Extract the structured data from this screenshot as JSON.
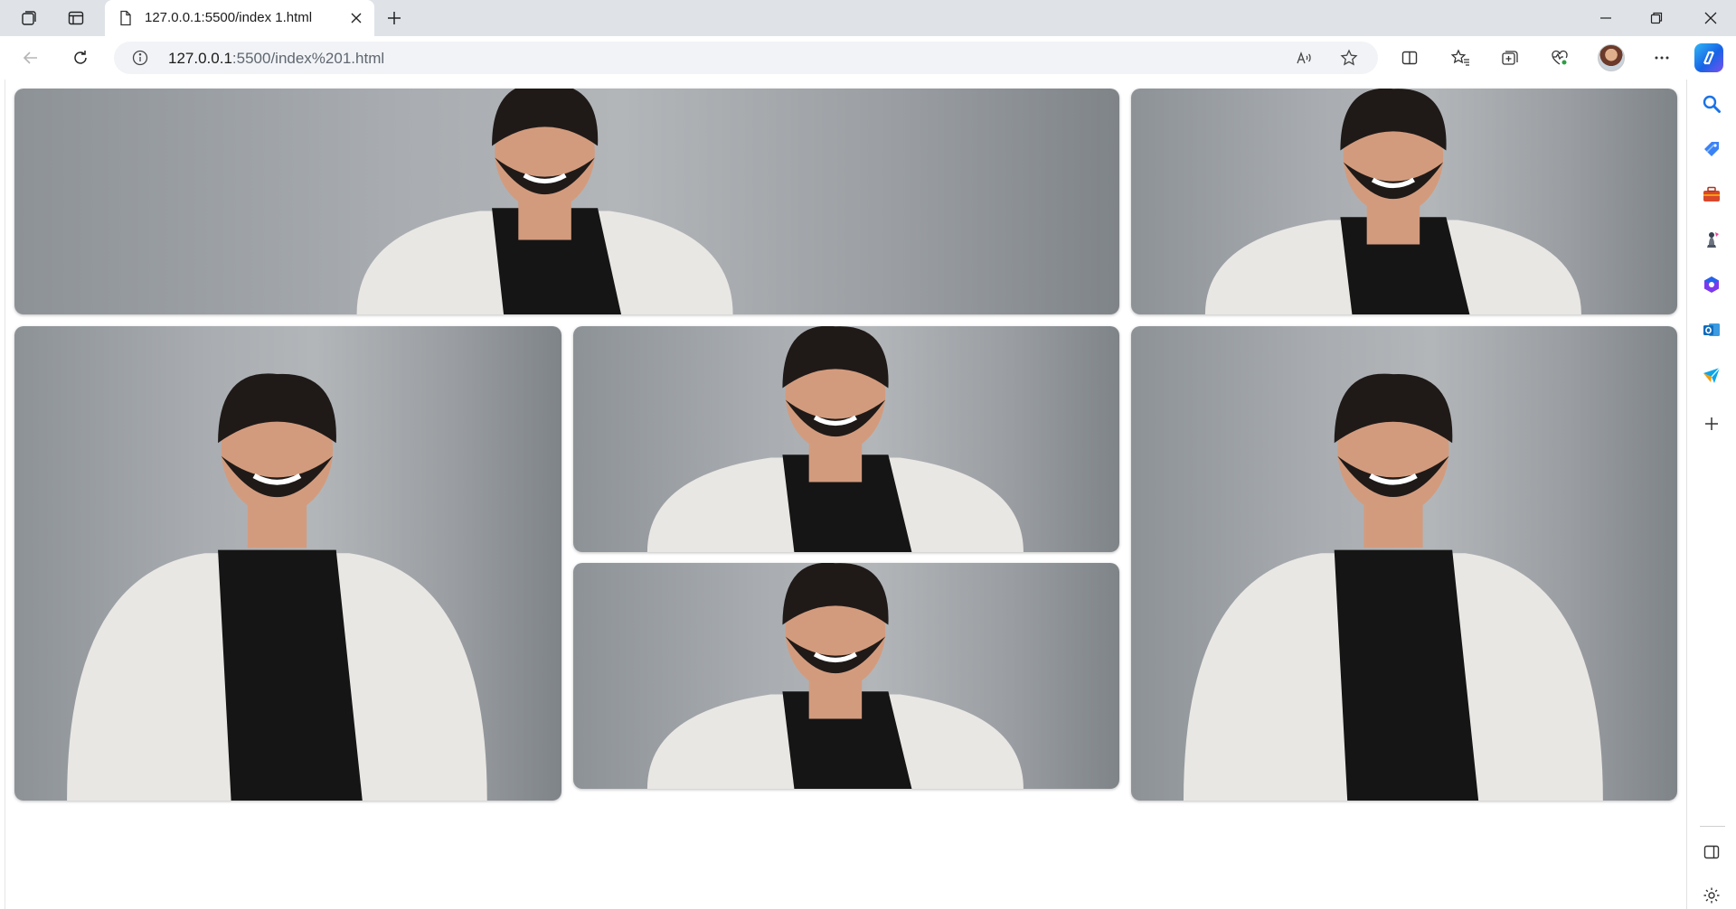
{
  "browser": {
    "tab": {
      "title": "127.0.0.1:5500/index 1.html"
    },
    "address": {
      "host": "127.0.0.1",
      "rest": ":5500/index%201.html"
    },
    "icons": {
      "workspaces": "workspaces-icon",
      "tab_actions": "tab-actions-icon",
      "page": "page-icon",
      "close_tab": "close-icon",
      "new_tab": "plus-icon",
      "minimize": "minimize-icon",
      "restore": "restore-icon",
      "close_window": "close-icon",
      "back": "back-arrow-icon",
      "refresh": "refresh-icon",
      "site_info": "info-icon",
      "read_aloud": "read-aloud-icon",
      "favorite": "star-icon",
      "split_screen": "split-screen-icon",
      "favorites": "favorites-icon",
      "collections": "collections-icon",
      "browser_essentials": "heart-pulse-icon",
      "more": "more-icon",
      "copilot": "copilot-icon"
    }
  },
  "sidebar": {
    "items": [
      {
        "name": "search-icon"
      },
      {
        "name": "shopping-tag-icon"
      },
      {
        "name": "tools-briefcase-icon"
      },
      {
        "name": "games-icon"
      },
      {
        "name": "microsoft-365-icon"
      },
      {
        "name": "outlook-icon"
      },
      {
        "name": "send-icon"
      },
      {
        "name": "add-icon"
      },
      {
        "name": "hide-sidebar-icon"
      },
      {
        "name": "settings-icon"
      }
    ]
  },
  "gallery": {
    "images": [
      {
        "name": "photo-wide-top-left",
        "crop": "wide"
      },
      {
        "name": "photo-top-right",
        "crop": "medium"
      },
      {
        "name": "photo-tall-left",
        "crop": "tall"
      },
      {
        "name": "photo-middle-upper",
        "crop": "medium"
      },
      {
        "name": "photo-middle-lower",
        "crop": "medium"
      },
      {
        "name": "photo-tall-right",
        "crop": "tall"
      }
    ]
  },
  "colors": {
    "tabbar": "#dfe3e8",
    "photo_background": "#a9adb1",
    "blazer": "#e9e7e4",
    "shirt": "#151515",
    "skin": "#d39b7d",
    "hair": "#1f1a18"
  }
}
